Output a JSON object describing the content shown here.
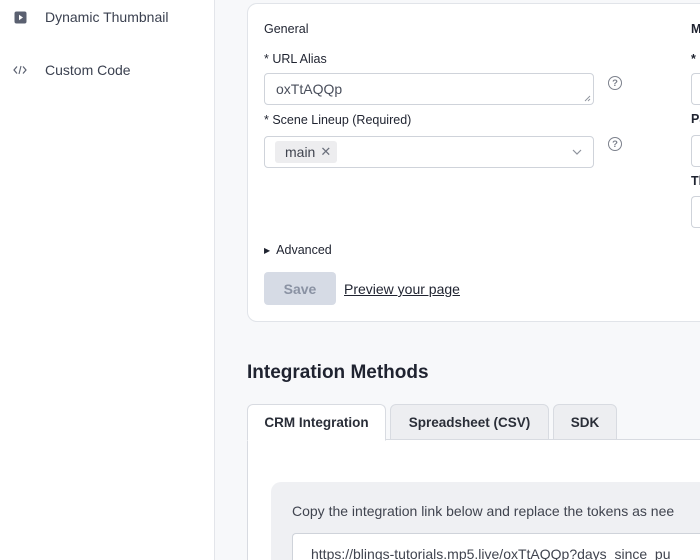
{
  "sidebar": {
    "items": [
      {
        "label": "Dynamic Thumbnail",
        "icon": "play-square-icon"
      },
      {
        "label": "Custom Code",
        "icon": "code-icon"
      }
    ]
  },
  "general": {
    "title": "General",
    "url_alias": {
      "label": "* URL Alias",
      "value": "oxTtAQQp"
    },
    "scene_lineup": {
      "label": "* Scene Lineup (Required)",
      "tags": [
        "main"
      ]
    },
    "advanced_label": "Advanced",
    "save_label": "Save",
    "preview_label": "Preview your page"
  },
  "right_column": {
    "title": "M",
    "label_1": "*",
    "label_2": "Pa",
    "label_3": "Th"
  },
  "integration": {
    "title": "Integration Methods",
    "tabs": [
      {
        "label": "CRM Integration",
        "active": true
      },
      {
        "label": "Spreadsheet (CSV)",
        "active": false
      },
      {
        "label": "SDK",
        "active": false
      }
    ],
    "instructions": "Copy the integration link below and replace the tokens as nee",
    "link": "https://blings-tutorials.mp5.live/oxTtAQQp?days_since_pu"
  },
  "colors": {
    "sidebar_bg": "#ffffff",
    "page_bg": "#f7f8fa",
    "save_disabled_bg": "#d6dbe5"
  }
}
